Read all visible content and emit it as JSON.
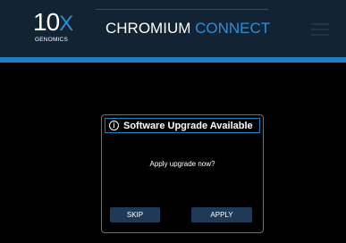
{
  "header": {
    "logo": {
      "text_main": "10",
      "text_x": "X",
      "text_sub": "GENOMICS"
    },
    "title_primary": "CHROMIUM",
    "title_accent": "CONNECT",
    "menu_icon": "hamburger-menu-icon"
  },
  "dialog": {
    "icon": "info-icon",
    "icon_glyph": "i",
    "title": "Software Upgrade Available",
    "message": "Apply upgrade now?",
    "skip_label": "SKIP",
    "apply_label": "APPLY"
  },
  "colors": {
    "header_bg": "#122433",
    "accent": "#1e7fc4",
    "button_bg": "#1f3a57",
    "background": "#000000"
  }
}
